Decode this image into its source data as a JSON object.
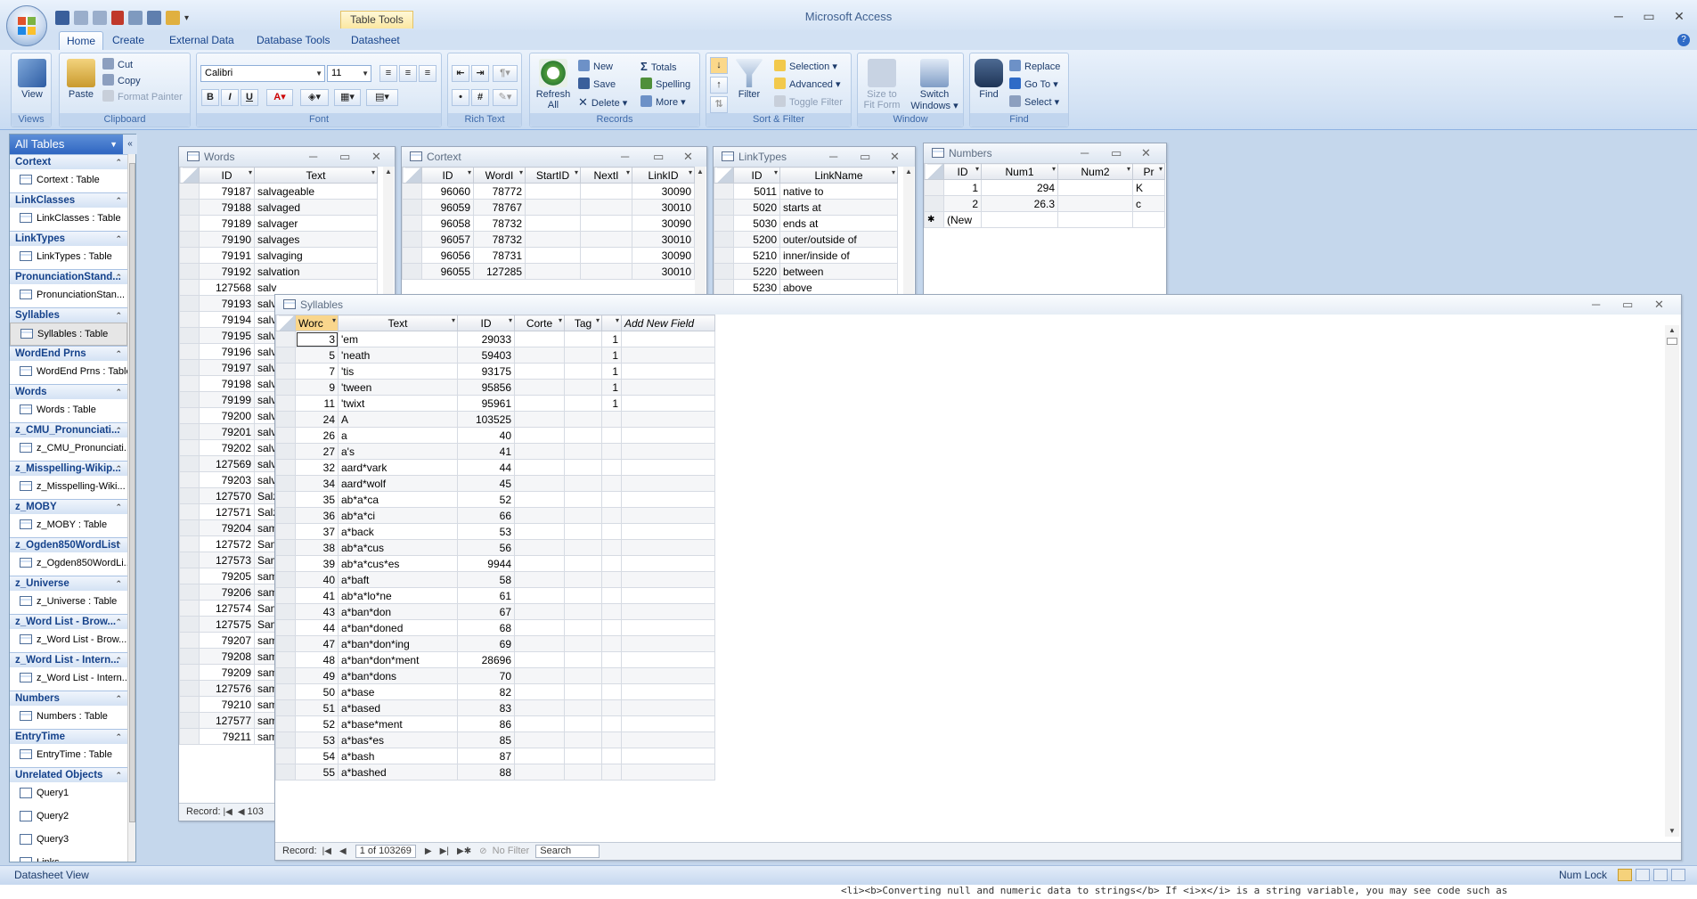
{
  "app_title": "Microsoft Access",
  "contextual_tab": "Table Tools",
  "ribbon_tabs": [
    "Home",
    "Create",
    "External Data",
    "Database Tools",
    "Datasheet"
  ],
  "ribbon": {
    "views": {
      "view": "View",
      "label": "Views"
    },
    "clipboard": {
      "paste": "Paste",
      "cut": "Cut",
      "copy": "Copy",
      "format_painter": "Format Painter",
      "label": "Clipboard"
    },
    "font": {
      "family": "Calibri",
      "size": "11",
      "bold": "B",
      "italic": "I",
      "underline": "U",
      "label": "Font"
    },
    "rich_text": {
      "label": "Rich Text"
    },
    "records": {
      "refresh": "Refresh All",
      "new": "New",
      "save": "Save",
      "delete": "Delete",
      "totals": "Totals",
      "spelling": "Spelling",
      "more": "More",
      "label": "Records"
    },
    "sort_filter": {
      "filter": "Filter",
      "selection": "Selection",
      "advanced": "Advanced",
      "toggle_filter": "Toggle Filter",
      "label": "Sort & Filter"
    },
    "window": {
      "size_to_fit": "Size to Fit Form",
      "switch_windows": "Switch Windows",
      "label": "Window"
    },
    "find": {
      "find": "Find",
      "replace": "Replace",
      "goto": "Go To",
      "select": "Select",
      "label": "Find"
    }
  },
  "nav": {
    "header": "All Tables",
    "groups": [
      {
        "name": "Cortext",
        "items": [
          "Cortext : Table"
        ]
      },
      {
        "name": "LinkClasses",
        "items": [
          "LinkClasses : Table"
        ]
      },
      {
        "name": "LinkTypes",
        "items": [
          "LinkTypes : Table"
        ]
      },
      {
        "name": "PronunciationStand...",
        "items": [
          "PronunciationStan..."
        ]
      },
      {
        "name": "Syllables",
        "items": [
          "Syllables : Table"
        ],
        "selected": true
      },
      {
        "name": "WordEnd Prns",
        "items": [
          "WordEnd Prns : Table"
        ]
      },
      {
        "name": "Words",
        "items": [
          "Words : Table"
        ]
      },
      {
        "name": "z_CMU_Pronunciati...",
        "items": [
          "z_CMU_Pronunciati..."
        ]
      },
      {
        "name": "z_Misspelling-Wikip...",
        "items": [
          "z_Misspelling-Wiki..."
        ]
      },
      {
        "name": "z_MOBY",
        "items": [
          "z_MOBY : Table"
        ]
      },
      {
        "name": "z_Ogden850WordList",
        "items": [
          "z_Ogden850WordLi..."
        ]
      },
      {
        "name": "z_Universe",
        "items": [
          "z_Universe : Table"
        ]
      },
      {
        "name": "z_Word List - Brow...",
        "items": [
          "z_Word List - Brow..."
        ]
      },
      {
        "name": "z_Word List - Intern...",
        "items": [
          "z_Word List - Intern..."
        ]
      },
      {
        "name": "Numbers",
        "items": [
          "Numbers : Table"
        ]
      },
      {
        "name": "EntryTime",
        "items": [
          "EntryTime : Table"
        ]
      },
      {
        "name": "Unrelated Objects",
        "items": [
          "Query1",
          "Query2",
          "Query3",
          "Links"
        ],
        "query": true
      }
    ]
  },
  "words": {
    "title": "Words",
    "headers": [
      "ID",
      "Text"
    ],
    "rows": [
      [
        "79187",
        "salvageable"
      ],
      [
        "79188",
        "salvaged"
      ],
      [
        "79189",
        "salvager"
      ],
      [
        "79190",
        "salvages"
      ],
      [
        "79191",
        "salvaging"
      ],
      [
        "79192",
        "salvation"
      ],
      [
        "127568",
        "salv"
      ],
      [
        "79193",
        "salv"
      ],
      [
        "79194",
        "salv"
      ],
      [
        "79195",
        "salv"
      ],
      [
        "79196",
        "salv"
      ],
      [
        "79197",
        "salv"
      ],
      [
        "79198",
        "salv"
      ],
      [
        "79199",
        "salv"
      ],
      [
        "79200",
        "salv"
      ],
      [
        "79201",
        "salv"
      ],
      [
        "79202",
        "salv"
      ],
      [
        "127569",
        "salv"
      ],
      [
        "79203",
        "salv"
      ],
      [
        "127570",
        "Salz"
      ],
      [
        "127571",
        "Salz"
      ],
      [
        "79204",
        "sam"
      ],
      [
        "127572",
        "Sam"
      ],
      [
        "127573",
        "Sam"
      ],
      [
        "79205",
        "sam"
      ],
      [
        "79206",
        "sam"
      ],
      [
        "127574",
        "Sam"
      ],
      [
        "127575",
        "Sam"
      ],
      [
        "79207",
        "sam"
      ],
      [
        "79208",
        "sam"
      ],
      [
        "79209",
        "sam"
      ],
      [
        "127576",
        "sam"
      ],
      [
        "79210",
        "sam"
      ],
      [
        "127577",
        "sam"
      ],
      [
        "79211",
        "sam"
      ]
    ],
    "record": "Record:",
    "record_value": "103"
  },
  "cortext": {
    "title": "Cortext",
    "headers": [
      "ID",
      "WordI",
      "StartID",
      "NextI",
      "LinkID"
    ],
    "rows": [
      [
        "96060",
        "78772",
        "",
        "",
        "30090"
      ],
      [
        "96059",
        "78767",
        "",
        "",
        "30010"
      ],
      [
        "96058",
        "78732",
        "",
        "",
        "30090"
      ],
      [
        "96057",
        "78732",
        "",
        "",
        "30010"
      ],
      [
        "96056",
        "78731",
        "",
        "",
        "30090"
      ],
      [
        "96055",
        "127285",
        "",
        "",
        "30010"
      ]
    ]
  },
  "linktypes": {
    "title": "LinkTypes",
    "headers": [
      "ID",
      "LinkName"
    ],
    "rows": [
      [
        "5011",
        "native to"
      ],
      [
        "5020",
        "starts at"
      ],
      [
        "5030",
        "ends at"
      ],
      [
        "5200",
        "outer/outside of"
      ],
      [
        "5210",
        "inner/inside of"
      ],
      [
        "5220",
        "between"
      ],
      [
        "5230",
        "above"
      ]
    ]
  },
  "numbers": {
    "title": "Numbers",
    "headers": [
      "ID",
      "Num1",
      "Num2",
      "Pr"
    ],
    "rows": [
      [
        "1",
        "294",
        "",
        "K"
      ],
      [
        "2",
        "26.3",
        "",
        "c"
      ]
    ],
    "new_row": "(New"
  },
  "syllables": {
    "title": "Syllables",
    "headers": [
      "Worc",
      "Text",
      "ID",
      "Corte",
      "Tag",
      "",
      "Add New Field"
    ],
    "rows": [
      [
        "3",
        "'em",
        "29033",
        "",
        "",
        "1"
      ],
      [
        "5",
        "'neath",
        "59403",
        "",
        "",
        "1"
      ],
      [
        "7",
        "'tis",
        "93175",
        "",
        "",
        "1"
      ],
      [
        "9",
        "'tween",
        "95856",
        "",
        "",
        "1"
      ],
      [
        "11",
        "'twixt",
        "95961",
        "",
        "",
        "1"
      ],
      [
        "24",
        "A",
        "103525",
        "",
        "",
        ""
      ],
      [
        "26",
        "a",
        "40",
        "",
        "",
        ""
      ],
      [
        "27",
        "a's",
        "41",
        "",
        "",
        ""
      ],
      [
        "32",
        "aard*vark",
        "44",
        "",
        "",
        ""
      ],
      [
        "34",
        "aard*wolf",
        "45",
        "",
        "",
        ""
      ],
      [
        "35",
        "ab*a*ca",
        "52",
        "",
        "",
        ""
      ],
      [
        "36",
        "ab*a*ci",
        "66",
        "",
        "",
        ""
      ],
      [
        "37",
        "a*back",
        "53",
        "",
        "",
        ""
      ],
      [
        "38",
        "ab*a*cus",
        "56",
        "",
        "",
        ""
      ],
      [
        "39",
        "ab*a*cus*es",
        "9944",
        "",
        "",
        ""
      ],
      [
        "40",
        "a*baft",
        "58",
        "",
        "",
        ""
      ],
      [
        "41",
        "ab*a*lo*ne",
        "61",
        "",
        "",
        ""
      ],
      [
        "43",
        "a*ban*don",
        "67",
        "",
        "",
        ""
      ],
      [
        "44",
        "a*ban*doned",
        "68",
        "",
        "",
        ""
      ],
      [
        "47",
        "a*ban*don*ing",
        "69",
        "",
        "",
        ""
      ],
      [
        "48",
        "a*ban*don*ment",
        "28696",
        "",
        "",
        ""
      ],
      [
        "49",
        "a*ban*dons",
        "70",
        "",
        "",
        ""
      ],
      [
        "50",
        "a*base",
        "82",
        "",
        "",
        ""
      ],
      [
        "51",
        "a*based",
        "83",
        "",
        "",
        ""
      ],
      [
        "52",
        "a*base*ment",
        "86",
        "",
        "",
        ""
      ],
      [
        "53",
        "a*bas*es",
        "85",
        "",
        "",
        ""
      ],
      [
        "54",
        "a*bash",
        "87",
        "",
        "",
        ""
      ],
      [
        "55",
        "a*bashed",
        "88",
        "",
        "",
        ""
      ]
    ],
    "record_label": "Record:",
    "record_value": "1 of 103269",
    "no_filter": "No Filter",
    "search": "Search"
  },
  "status": {
    "left": "Datasheet View",
    "num_lock": "Num Lock"
  },
  "bottom_text": "<li><b>Converting null and numeric data to strings</b> If <i>x</i> is a string variable, you may see code such as"
}
